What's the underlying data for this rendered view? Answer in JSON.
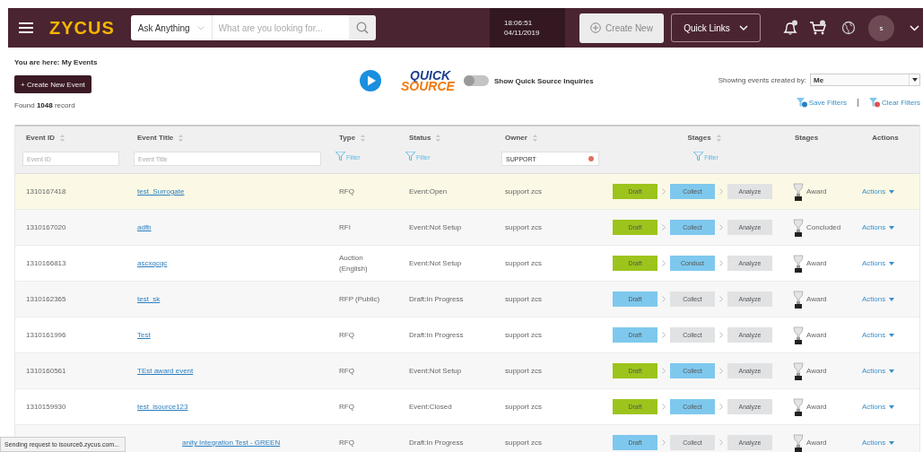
{
  "header": {
    "logo": "ZYCUS",
    "search": {
      "scope": "Ask Anything",
      "placeholder": "What are you looking for..."
    },
    "clock": {
      "time": "18:06:51",
      "date": "04/11/2019"
    },
    "create_button": "Create New",
    "quick_links": "Quick Links",
    "avatar_initial": "s"
  },
  "breadcrumb": "You are here: My Events",
  "create_event_button": "+ Create New Event",
  "quick_source": {
    "logo_line_1": "QUICK",
    "logo_line_2": "SOURCE",
    "toggle": {
      "label": "Show Quick Source Inquiries",
      "on": false
    }
  },
  "created_by": {
    "label": "Showing events created by:",
    "value": "Me"
  },
  "record_count": "Found **1048** record",
  "filter_links": [
    "Save Filters",
    "Clear Filters"
  ],
  "table": {
    "columns": [
      {
        "label": "Event ID",
        "sortable": true
      },
      {
        "label": "Event Title",
        "sortable": true
      },
      {
        "label": "Type",
        "sortable": true
      },
      {
        "label": "Status",
        "sortable": true
      },
      {
        "label": "Owner",
        "sortable": true
      },
      {
        "label": "Stages",
        "sortable": true
      },
      {
        "label": "Stages",
        "sortable": false
      },
      {
        "label": "Actions",
        "sortable": false
      }
    ],
    "filters": [
      {
        "kind": "input",
        "placeholder": "Event ID"
      },
      {
        "kind": "input",
        "placeholder": "Event Title"
      },
      {
        "kind": "filter",
        "label": "Filter"
      },
      {
        "kind": "filter",
        "label": "Filter"
      },
      {
        "kind": "input",
        "value": "SUPPORT",
        "clearable": true
      },
      {
        "kind": "filter",
        "label": "Filter"
      },
      {
        "kind": "empty"
      },
      {
        "kind": "empty"
      }
    ],
    "rows": [
      {
        "event_id": "1310167418",
        "title": "test_Surrogate",
        "type": "RFQ",
        "status": "Event:Open",
        "owner": "support zcs",
        "stages": [
          {
            "label": "Draft",
            "color": "#9cc41c"
          },
          {
            "label": "Collect",
            "color": "#7ec8ee"
          },
          {
            "label": "Analyze",
            "color": "#e1e2e3"
          }
        ],
        "final_stage": "Award",
        "actions": "Actions",
        "selected": true
      },
      {
        "event_id": "1310167020",
        "title": "adfb",
        "type": "RFI",
        "status": "Event:Not Setup",
        "owner": "support zcs",
        "stages": [
          {
            "label": "Draft",
            "color": "#9cc41c"
          },
          {
            "label": "Collect",
            "color": "#7ec8ee"
          },
          {
            "label": "Analyze",
            "color": "#e1e2e3"
          }
        ],
        "final_stage": "Concluded",
        "actions": "Actions",
        "selected": false
      },
      {
        "event_id": "1310166813",
        "title": "ascxqcqc",
        "type": "Auction (English)",
        "status": "Event:Not Setup",
        "owner": "support zcs",
        "stages": [
          {
            "label": "Draft",
            "color": "#9cc41c"
          },
          {
            "label": "Conduct",
            "color": "#7ec8ee"
          },
          {
            "label": "Analyze",
            "color": "#e1e2e3"
          }
        ],
        "final_stage": "Award",
        "actions": "Actions",
        "selected": false
      },
      {
        "event_id": "1310162365",
        "title": "test_sk",
        "type": "RFP (Public)",
        "status": "Draft:In Progress",
        "owner": "support zcs",
        "stages": [
          {
            "label": "Draft",
            "color": "#7ec8ee"
          },
          {
            "label": "Collect",
            "color": "#e1e2e3"
          },
          {
            "label": "Analyze",
            "color": "#e1e2e3"
          }
        ],
        "final_stage": "Award",
        "actions": "Actions",
        "selected": false
      },
      {
        "event_id": "1310161996",
        "title": "Test",
        "type": "RFQ",
        "status": "Draft:In Progress",
        "owner": "support zcs",
        "stages": [
          {
            "label": "Draft",
            "color": "#7ec8ee"
          },
          {
            "label": "Collect",
            "color": "#e1e2e3"
          },
          {
            "label": "Analyze",
            "color": "#e1e2e3"
          }
        ],
        "final_stage": "Award",
        "actions": "Actions",
        "selected": false
      },
      {
        "event_id": "1310160561",
        "title": "TEst award event",
        "type": "RFQ",
        "status": "Event:Not Setup",
        "owner": "support zcs",
        "stages": [
          {
            "label": "Draft",
            "color": "#9cc41c"
          },
          {
            "label": "Collect",
            "color": "#7ec8ee"
          },
          {
            "label": "Analyze",
            "color": "#e1e2e3"
          }
        ],
        "final_stage": "Award",
        "actions": "Actions",
        "selected": false
      },
      {
        "event_id": "1310159930",
        "title": "test_isource123",
        "type": "RFQ",
        "status": "Event:Closed",
        "owner": "support zcs",
        "stages": [
          {
            "label": "Draft",
            "color": "#9cc41c"
          },
          {
            "label": "Collect",
            "color": "#7ec8ee"
          },
          {
            "label": "Analyze",
            "color": "#e1e2e3"
          }
        ],
        "final_stage": "Award",
        "actions": "Actions",
        "selected": false
      },
      {
        "title": "anity Integration Test - GREEN",
        "type": "RFQ",
        "status": "Draft:In Progress",
        "owner": "support zcs",
        "stages": [
          {
            "label": "Draft",
            "color": "#7ec8ee"
          },
          {
            "label": "Collect",
            "color": "#e1e2e3"
          },
          {
            "label": "Analyze",
            "color": "#e1e2e3"
          }
        ],
        "final_stage": "Award",
        "actions": "Actions",
        "selected": false
      }
    ]
  },
  "status_message": "Sending request to isource6.zycus.com..."
}
